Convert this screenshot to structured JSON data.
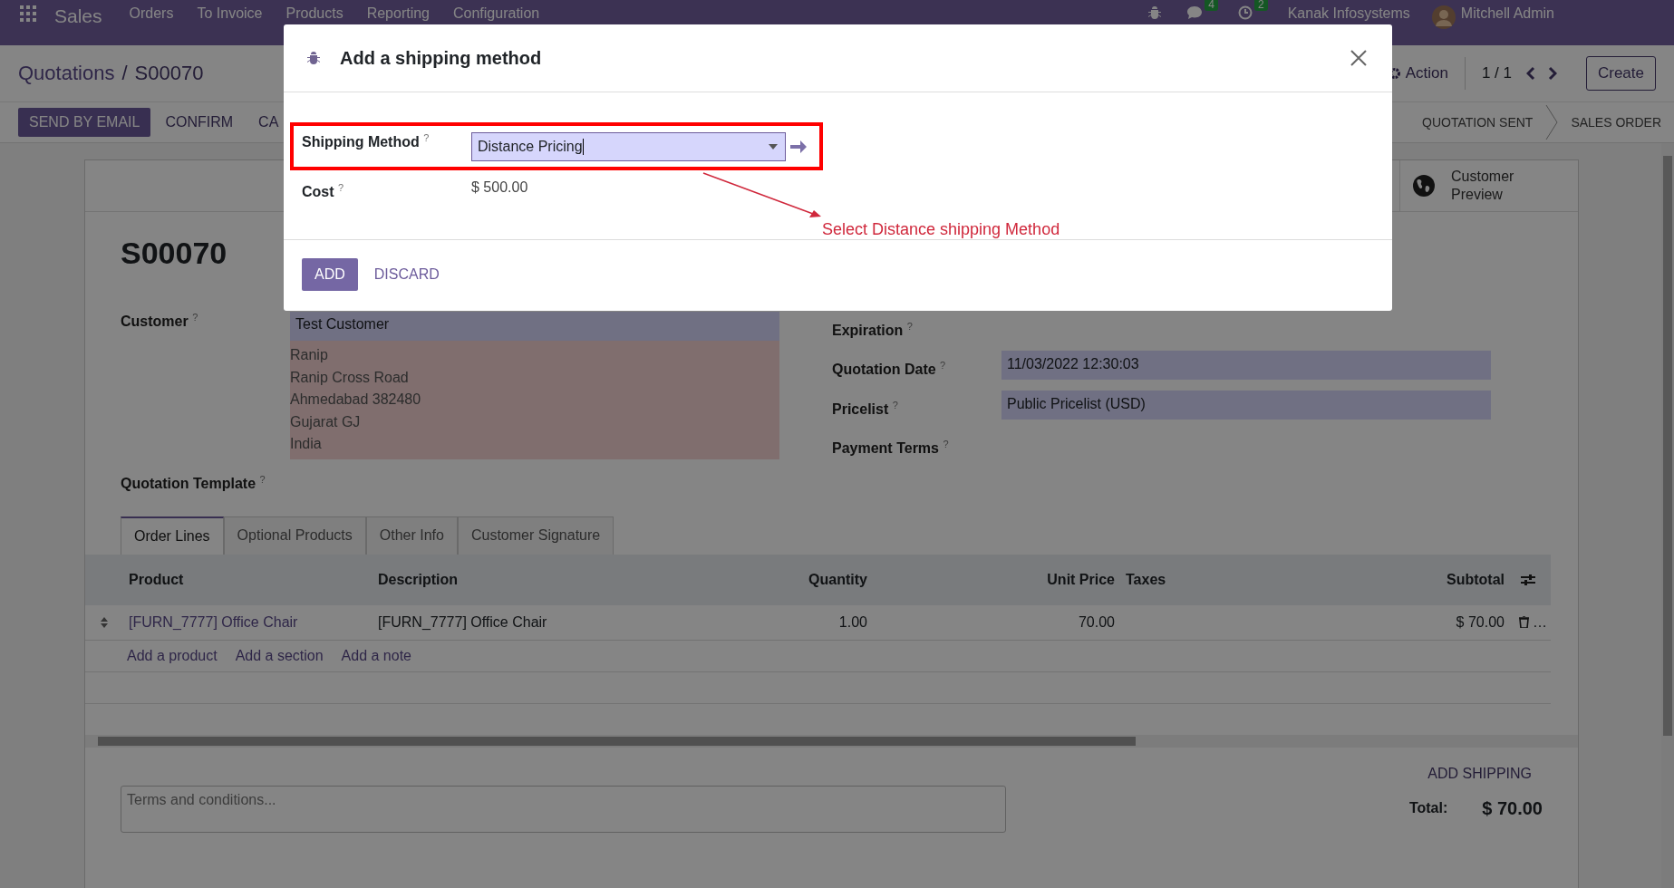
{
  "top_bar": {
    "app": "Sales",
    "menu": [
      "Orders",
      "To Invoice",
      "Products",
      "Reporting",
      "Configuration"
    ],
    "badges": [
      {
        "kind": "chat",
        "count": "4"
      },
      {
        "kind": "clock",
        "count": "2"
      }
    ],
    "company": "Kanak Infosystems",
    "user": "Mitchell Admin"
  },
  "breadcrumb": {
    "parent": "Quotations",
    "separator": "/",
    "current": "S00070"
  },
  "control": {
    "action": "Action",
    "pager": "1 / 1",
    "create": "Create"
  },
  "buttons": [
    {
      "label": "SEND BY EMAIL",
      "primary": true
    },
    {
      "label": "CONFIRM",
      "primary": false
    },
    {
      "label": "CA",
      "primary": false
    }
  ],
  "status_steps": [
    "QUOTATION SENT",
    "SALES ORDER"
  ],
  "smart_button": "Customer Preview",
  "form": {
    "title": "S00070",
    "customer": {
      "label": "Customer $^{?}$",
      "value": "Test Customer",
      "address": [
        "Ranip",
        "Ranip Cross Road",
        "Ahmedabad 382480",
        "Gujarat GJ",
        "India"
      ]
    },
    "template_label": "Quotation Template $^{?}$",
    "right_fields": [
      {
        "label": "Expiration $^{?}$"
      },
      {
        "label": "Quotation Date $^{?}$",
        "value": "11/03/2022 12:30:03"
      },
      {
        "label": "Pricelist $^{?}$",
        "value": "Public Pricelist (USD)"
      },
      {
        "label": "Payment Terms $^{?}$"
      }
    ]
  },
  "tabs": [
    {
      "label": "Order Lines",
      "selected": true
    },
    {
      "label": "Optional Products",
      "selected": false
    },
    {
      "label": "Other Info",
      "selected": false
    },
    {
      "label": "Customer Signature",
      "selected": false
    }
  ],
  "table": {
    "columns": [
      "Product",
      "Description",
      "Quantity",
      "Unit Price",
      "Taxes",
      "Subtotal"
    ],
    "rows": [
      {
        "cells": [
          "[FURN_7777] Office Chair",
          "[FURN_7777] Office Chair",
          "1.00",
          "70.00",
          "",
          "$ 70.00"
        ],
        "more": "…"
      }
    ],
    "add_links": [
      "Add a product",
      "Add a section",
      "Add a note"
    ]
  },
  "terms": {
    "placeholder": "Terms and conditions..."
  },
  "add_shipping": "ADD SHIPPING",
  "total": {
    "label": "Total:",
    "value": "$ 70.00"
  },
  "dialog": {
    "title": "Add a shipping method",
    "fields": [
      {
        "label": "Shipping Method $^{?}$",
        "kind": "select",
        "value": "Distance Pricing",
        "highlighted": true
      },
      {
        "label": "Cost $^{?}$",
        "kind": "text",
        "value": "$ 500.00"
      }
    ],
    "buttons": [
      {
        "label": "ADD",
        "primary": true
      },
      {
        "label": "DISCARD",
        "primary": false
      }
    ]
  },
  "annotation": {
    "text": "Select Distance shipping Method"
  }
}
